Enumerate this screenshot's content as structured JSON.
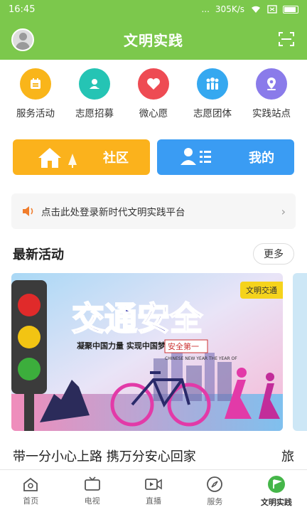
{
  "status_bar": {
    "time": "16:45",
    "dots": "...",
    "speed": "305K/s"
  },
  "header": {
    "title": "文明实践"
  },
  "quick_actions": [
    {
      "label": "服务活动",
      "color": "#f9b51a",
      "icon": "calendar-icon"
    },
    {
      "label": "志愿招募",
      "color": "#25c4b4",
      "icon": "heart-hand-icon"
    },
    {
      "label": "微心愿",
      "color": "#ee4b53",
      "icon": "heart-icon"
    },
    {
      "label": "志愿团体",
      "color": "#35a8f0",
      "icon": "group-icon"
    },
    {
      "label": "实践站点",
      "color": "#8a7bea",
      "icon": "location-pin-icon"
    }
  ],
  "banners": {
    "community": "社区",
    "mine": "我的"
  },
  "notice": {
    "text": "点击此处登录新时代文明实践平台"
  },
  "latest": {
    "title": "最新活动",
    "more": "更多"
  },
  "card": {
    "tag": "文明交通",
    "headline": "交通安全",
    "slogan": "凝聚中国力量 实现中国梦",
    "seal": "安全第一",
    "english": "CHINESE NEW YEAR THE YEAR OF",
    "title": "带一分小心上路 携万分安心回家",
    "next_title_char": "旅"
  },
  "tabs": [
    {
      "label": "首页",
      "icon": "home-icon"
    },
    {
      "label": "电视",
      "icon": "tv-icon"
    },
    {
      "label": "直播",
      "icon": "video-icon"
    },
    {
      "label": "服务",
      "icon": "compass-icon"
    },
    {
      "label": "文明实践",
      "icon": "flag-icon",
      "active": true
    }
  ]
}
